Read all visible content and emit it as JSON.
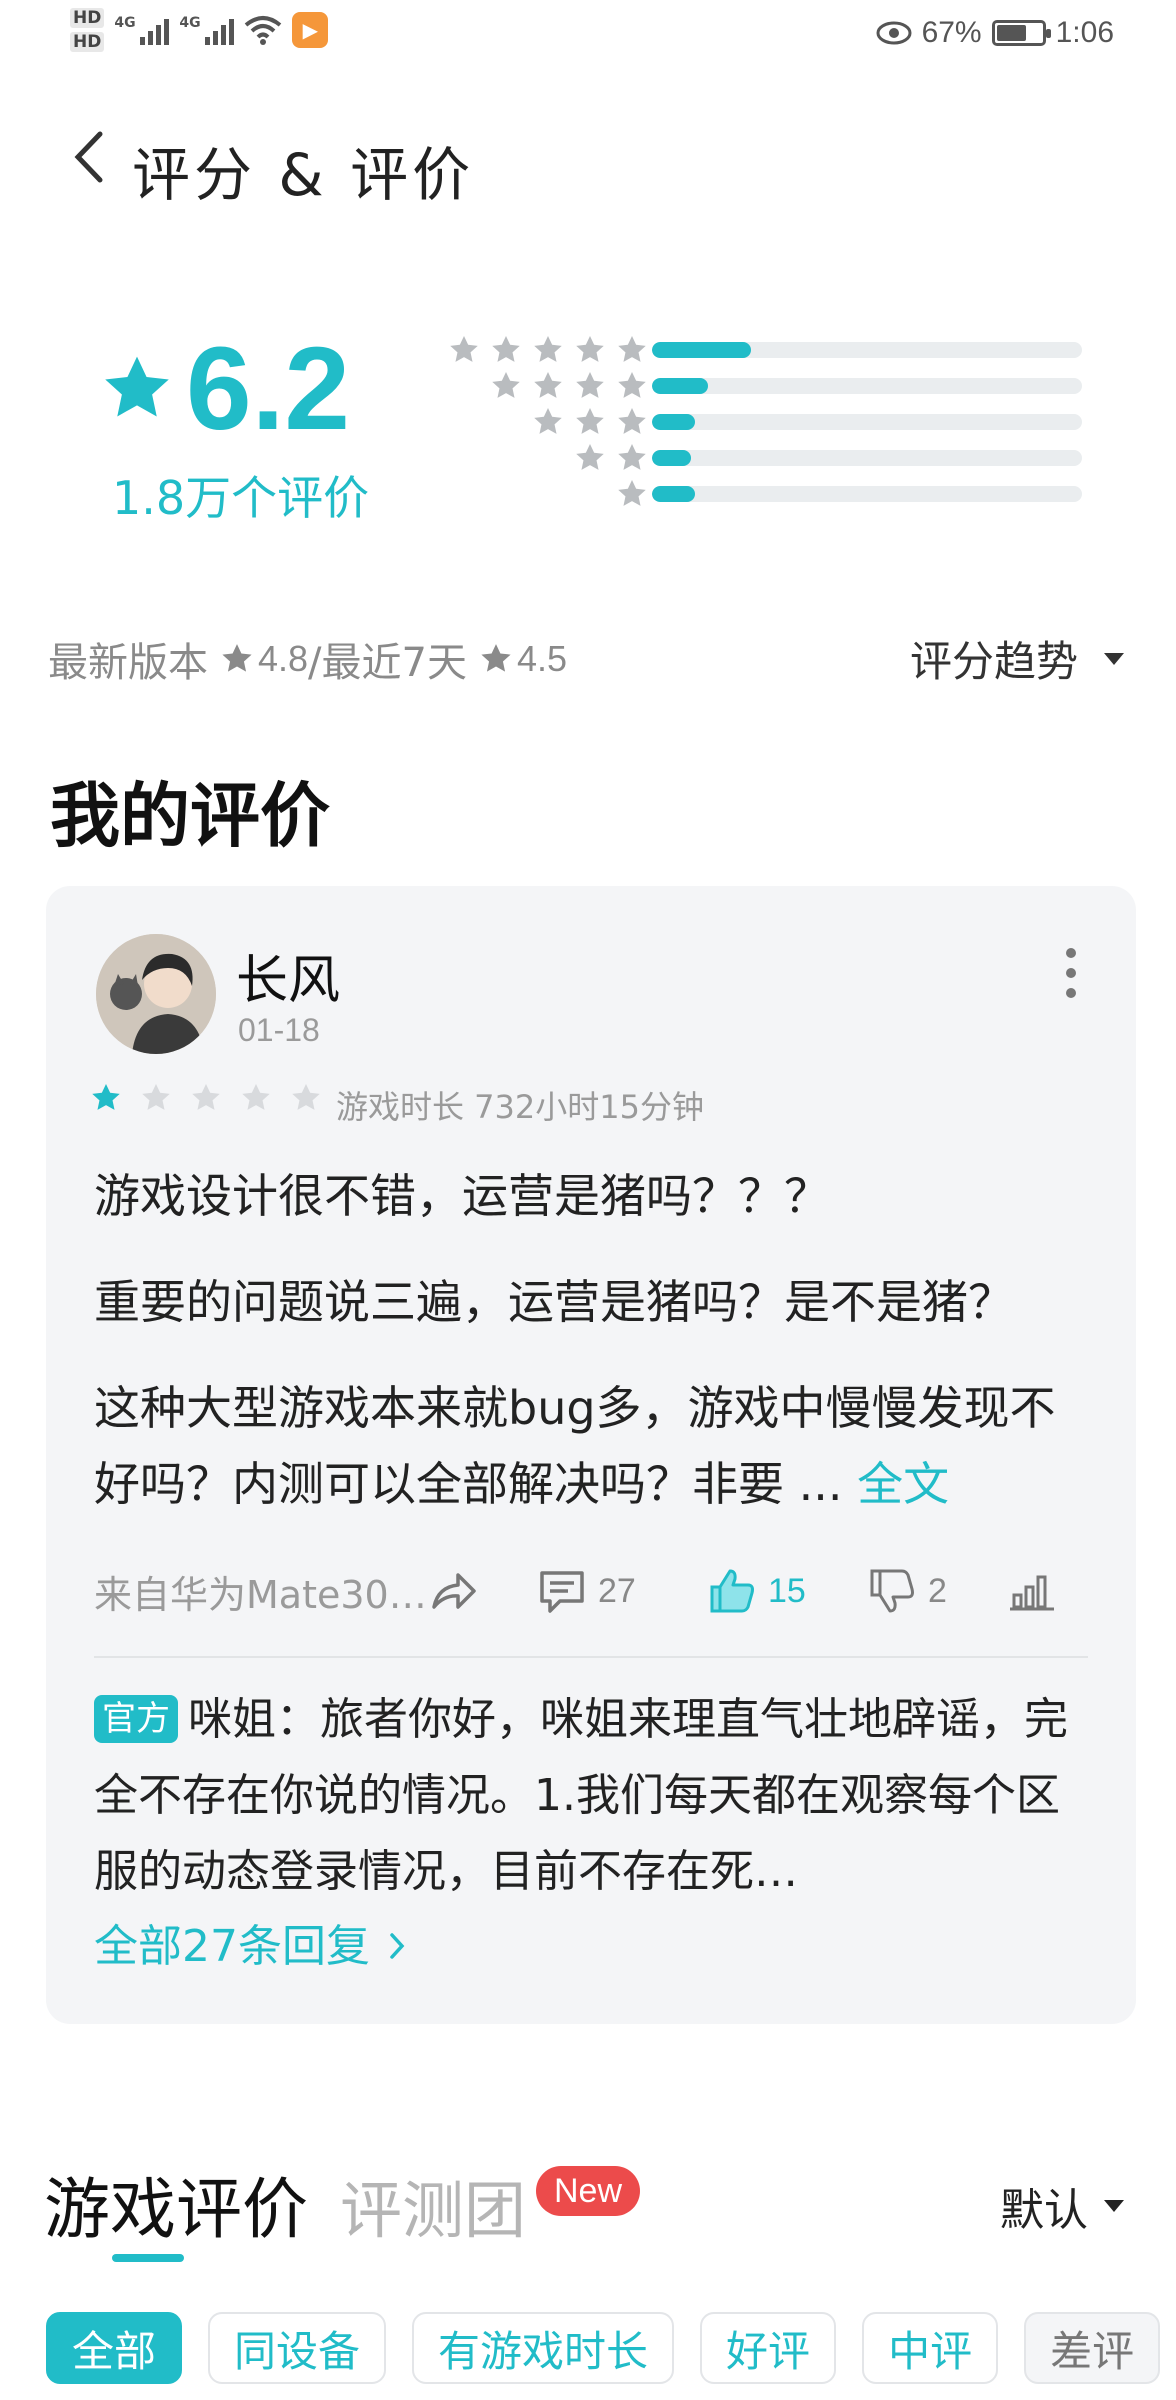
{
  "status_bar": {
    "hd1": "HD",
    "hd2": "HD",
    "signal1": "4G",
    "signal2": "4G",
    "battery_percent": "67%",
    "battery_level": 0.67,
    "time": "1:06"
  },
  "header": {
    "title": "评分 & 评价"
  },
  "rating": {
    "score": "6.2",
    "count": "1.8万个评价",
    "distribution": [
      {
        "stars": 5,
        "fraction": 0.23
      },
      {
        "stars": 4,
        "fraction": 0.13
      },
      {
        "stars": 3,
        "fraction": 0.1
      },
      {
        "stars": 2,
        "fraction": 0.09
      },
      {
        "stars": 1,
        "fraction": 0.1
      }
    ]
  },
  "version": {
    "latest_label": "最新版本",
    "latest_score": "4.8",
    "recent_label": "/最近7天",
    "recent_score": "4.5",
    "trend_label": "评分趋势"
  },
  "my_review": {
    "section_title": "我的评价",
    "username": "长风",
    "date": "01-18",
    "stars": 1,
    "playtime": "游戏时长 732小时15分钟",
    "paragraph1": "游戏设计很不错，运营是猪吗？？？",
    "paragraph2": "重要的问题说三遍，运营是猪吗？是不是猪？",
    "paragraph3": "这种大型游戏本来就bug多，游戏中慢慢发现不好吗？内测可以全部解决吗？非要 ... ",
    "full_text_link": "全文",
    "device": "来自华为Mate30…",
    "comments": "27",
    "likes": "15",
    "dislikes": "2",
    "official_tag": "官方",
    "official_reply": "咪姐：旅者你好，咪姐来理直气壮地辟谣，完全不存在你说的情况。1.我们每天都在观察每个区服的动态登录情况，目前不存在死…",
    "all_replies": "全部27条回复",
    "colors": {
      "accent": "#21bcc8",
      "card_bg": "#f4f5f7"
    }
  },
  "game_reviews": {
    "tab_game": "游戏评价",
    "tab_review_team": "评测团",
    "new_badge": "New",
    "sort_label": "默认",
    "filters": [
      "全部",
      "同设备",
      "有游戏时长",
      "好评",
      "中评",
      "差评"
    ]
  }
}
